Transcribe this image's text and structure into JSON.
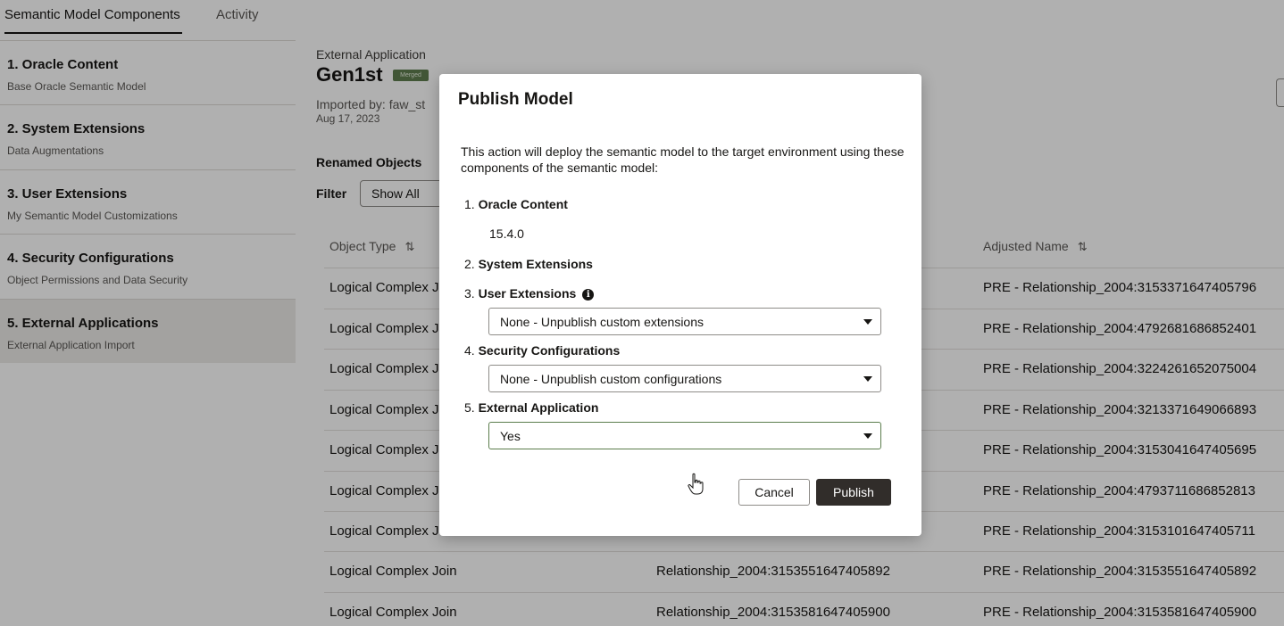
{
  "tabs": [
    {
      "label": "Semantic Model Components",
      "active": true
    },
    {
      "label": "Activity",
      "active": false
    }
  ],
  "sidebar": {
    "items": [
      {
        "title": "1. Oracle Content",
        "subtitle": "Base Oracle Semantic Model"
      },
      {
        "title": "2. System Extensions",
        "subtitle": "Data Augmentations"
      },
      {
        "title": "3. User Extensions",
        "subtitle": "My Semantic Model Customizations"
      },
      {
        "title": "4. Security Configurations",
        "subtitle": "Object Permissions and Data Security"
      },
      {
        "title": "5. External Applications",
        "subtitle": "External Application Import",
        "selected": true
      }
    ]
  },
  "main": {
    "label": "External Application",
    "title": "Gen1st",
    "badge": "Merged",
    "imported_by": "Imported by: faw_st",
    "imported_date": "Aug 17, 2023",
    "renamed_heading": "Renamed Objects",
    "filter_label": "Filter",
    "filter_value": "Show All",
    "table": {
      "columns": [
        "Object Type",
        "",
        "Adjusted Name"
      ],
      "rows": [
        [
          "Logical Complex Join",
          "",
          "PRE - Relationship_2004:3153371647405796"
        ],
        [
          "Logical Complex Join",
          "",
          "PRE - Relationship_2004:4792681686852401"
        ],
        [
          "Logical Complex Join",
          "",
          "PRE - Relationship_2004:3224261652075004"
        ],
        [
          "Logical Complex Join",
          "",
          "PRE - Relationship_2004:3213371649066893"
        ],
        [
          "Logical Complex Join",
          "",
          "PRE - Relationship_2004:3153041647405695"
        ],
        [
          "Logical Complex Join",
          "",
          "PRE - Relationship_2004:4793711686852813"
        ],
        [
          "Logical Complex Join",
          "",
          "PRE - Relationship_2004:3153101647405711"
        ],
        [
          "Logical Complex Join",
          "Relationship_2004:3153551647405892",
          "PRE - Relationship_2004:3153551647405892"
        ],
        [
          "Logical Complex Join",
          "Relationship_2004:3153581647405900",
          "PRE - Relationship_2004:3153581647405900"
        ]
      ]
    }
  },
  "modal": {
    "title": "Publish Model",
    "description": "This action will deploy the semantic model to the target environment using these components of the semantic model:",
    "sections": [
      {
        "num": "1.",
        "label": "Oracle Content",
        "version": "15.4.0"
      },
      {
        "num": "2.",
        "label": "System Extensions"
      },
      {
        "num": "3.",
        "label": "User Extensions",
        "select": "None - Unpublish custom extensions"
      },
      {
        "num": "4.",
        "label": "Security Configurations",
        "select": "None - Unpublish custom configurations"
      },
      {
        "num": "5.",
        "label": "External Application",
        "select": "Yes"
      }
    ],
    "info_icon": "i",
    "cancel_label": "Cancel",
    "publish_label": "Publish"
  },
  "icons": {
    "sort": "sort-arrows-icon",
    "info": "info-icon",
    "caret": "caret-down-icon",
    "cursor": "hand-pointer-icon"
  },
  "colors": {
    "primary_button": "#312d2a",
    "badge": "#5f7d4f",
    "overlay": "rgba(0,0,0,0.31)"
  }
}
